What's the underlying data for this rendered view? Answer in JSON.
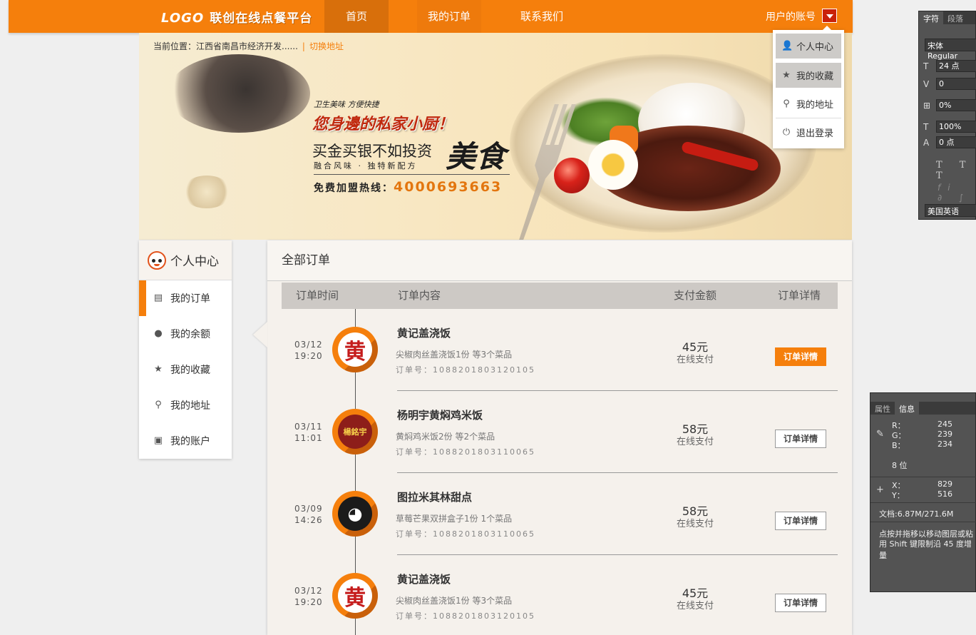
{
  "header": {
    "logo_text": "LOGO",
    "brand": "联创在线点餐平台",
    "nav": [
      "首页",
      "我的订单",
      "联系我们"
    ],
    "account_label": "用户的账号"
  },
  "breadcrumb": {
    "prefix": "当前位置：",
    "location": "江西省南昌市经济开发......",
    "switch_label": "切换地址"
  },
  "banner": {
    "small_slogan": "卫生美味 方便快捷",
    "main_slogan": "您身邊的私家小厨！",
    "line1": "买金买银不如投资",
    "script_word": "美食",
    "line2": "融合风味 · 独特新配方",
    "hotline_label": "免费加盟热线：",
    "hotline_number": "4000693663"
  },
  "sidebar": {
    "title": "个人中心",
    "items": [
      {
        "label": "我的订单",
        "icon": "clipboard-icon"
      },
      {
        "label": "我的余额",
        "icon": "money-bag-icon"
      },
      {
        "label": "我的收藏",
        "icon": "star-icon"
      },
      {
        "label": "我的地址",
        "icon": "location-pin-icon"
      },
      {
        "label": "我的账户",
        "icon": "wallet-icon"
      }
    ]
  },
  "main": {
    "title": "全部订单",
    "columns": [
      "订单时间",
      "订单内容",
      "支付金额",
      "订单详情"
    ],
    "orders": [
      {
        "date": "03/12",
        "time": "19:20",
        "restaurant": "黄记盖浇饭",
        "logo_text": "黄",
        "dishes": "尖椒肉丝盖浇饭1份 等3个菜品",
        "order_no": "订单号：1088201803120105",
        "amount": "45元",
        "pay_method": "在线支付",
        "detail_label": "订单详情"
      },
      {
        "date": "03/11",
        "time": "11:01",
        "restaurant": "杨明宇黄焖鸡米饭",
        "logo_text": "楊銘宇",
        "dishes": "黄焖鸡米饭2份 等2个菜品",
        "order_no": "订单号：1088201803110065",
        "amount": "58元",
        "pay_method": "在线支付",
        "detail_label": "订单详情"
      },
      {
        "date": "03/09",
        "time": "14:26",
        "restaurant": "图拉米其林甜点",
        "logo_text": "◕",
        "dishes": "草莓芒果双拼盒子1份 1个菜品",
        "order_no": "订单号：1088201803110065",
        "amount": "58元",
        "pay_method": "在线支付",
        "detail_label": "订单详情"
      },
      {
        "date": "03/12",
        "time": "19:20",
        "restaurant": "黄记盖浇饭",
        "logo_text": "黄",
        "dishes": "尖椒肉丝盖浇饭1份 等3个菜品",
        "order_no": "订单号：1088201803120105",
        "amount": "45元",
        "pay_method": "在线支付",
        "detail_label": "订单详情"
      }
    ]
  },
  "account_menu": {
    "items": [
      {
        "label": "个人中心",
        "icon": "user-icon"
      },
      {
        "label": "我的收藏",
        "icon": "star-icon"
      },
      {
        "label": "我的地址",
        "icon": "location-pin-icon"
      },
      {
        "label": "退出登录",
        "icon": "power-icon"
      }
    ]
  },
  "ps_character_panel": {
    "tabs": [
      "字符",
      "段落"
    ],
    "font": "宋体 Regular",
    "size": "24 点",
    "kerning": "0",
    "tracking": "0%",
    "vscale": "100%",
    "baseline": "0 点",
    "style_buttons": "T T T",
    "language": "美国英语"
  },
  "ps_info_panel": {
    "tabs": [
      "属性",
      "信息"
    ],
    "r_label": "R：",
    "r": "245",
    "g_label": "G：",
    "g": "239",
    "b_label": "B：",
    "b": "234",
    "bit_depth": "8 位",
    "x_label": "X：",
    "x": "829",
    "y_label": "Y：",
    "y": "516",
    "doc": "文档:6.87M/271.6M",
    "hint1": "点按并拖移以移动图层或粘",
    "hint2": "用 Shift 键限制沿 45 度增量"
  },
  "colors": {
    "accent": "#f57f0c",
    "accent_dark": "#d86f0b",
    "panel_bg": "#f5f1ec",
    "ps_bg": "#535353"
  }
}
